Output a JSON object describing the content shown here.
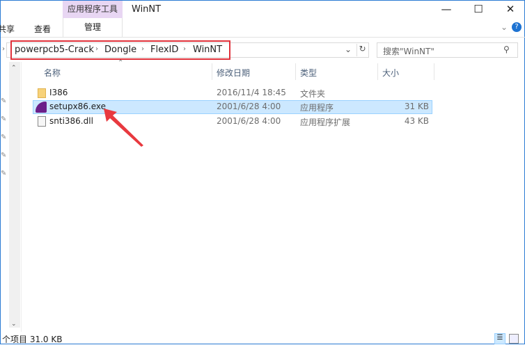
{
  "titlebar": {
    "context_tab": "应用程序工具",
    "title": "WinNT",
    "minimize": "—",
    "maximize": "☐",
    "close": "✕"
  },
  "ribbon": {
    "tabs": [
      "共享",
      "查看",
      "管理"
    ]
  },
  "address": {
    "crumbs": [
      "powerpcb5-Crack",
      "Dongle",
      "FlexID",
      "WinNT"
    ],
    "search_placeholder": "搜索\"WinNT\""
  },
  "columns": [
    "名称",
    "修改日期",
    "类型",
    "大小"
  ],
  "files": [
    {
      "name": "I386",
      "date": "2016/11/4 18:45",
      "type": "文件夹",
      "size": "",
      "icon": "folder-icon"
    },
    {
      "name": "setupx86.exe",
      "date": "2001/6/28 4:00",
      "type": "应用程序",
      "size": "31 KB",
      "icon": "exe-icon",
      "selected": true
    },
    {
      "name": "snti386.dll",
      "date": "2001/6/28 4:00",
      "type": "应用程序扩展",
      "size": "43 KB",
      "icon": "dll-icon"
    }
  ],
  "status": {
    "text": "个项目  31.0 KB"
  },
  "colors": {
    "accent": "#cce8ff",
    "highlight": "#e0313a",
    "context": "#e8d6f3"
  }
}
